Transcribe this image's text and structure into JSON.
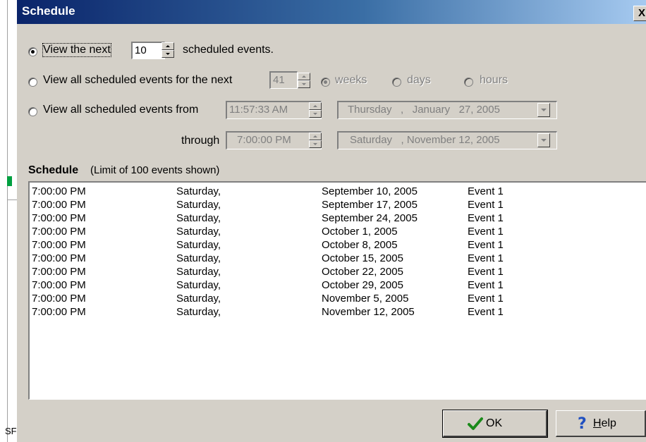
{
  "left_strip": {
    "fragment_text": "SF"
  },
  "dialog": {
    "title": "Schedule",
    "close_label": "X"
  },
  "options": {
    "next_events": {
      "label_prefix": "View the next",
      "value": "10",
      "label_suffix": "scheduled events.",
      "selected": true
    },
    "next_period": {
      "label": "View all scheduled events for the next",
      "value": "41",
      "units": [
        "weeks",
        "days",
        "hours"
      ],
      "selected_unit": "weeks"
    },
    "date_range": {
      "label_from": "View all scheduled events from",
      "from_time": "11:57:33 AM",
      "from_date": "Thursday   ,   January   27, 2005",
      "label_through": "through",
      "through_time": "7:00:00 PM",
      "through_date": "Saturday   , November 12, 2005"
    }
  },
  "schedule": {
    "heading": "Schedule",
    "limit_note": "(Limit of 100 events shown)",
    "rows": [
      {
        "time": "7:00:00 PM",
        "day": "Saturday,",
        "date": "September 10, 2005",
        "event": "Event 1"
      },
      {
        "time": "7:00:00 PM",
        "day": "Saturday,",
        "date": "September 17, 2005",
        "event": "Event 1"
      },
      {
        "time": "7:00:00 PM",
        "day": "Saturday,",
        "date": "September 24, 2005",
        "event": "Event 1"
      },
      {
        "time": "7:00:00 PM",
        "day": "Saturday,",
        "date": "October 1, 2005",
        "event": "Event 1"
      },
      {
        "time": "7:00:00 PM",
        "day": "Saturday,",
        "date": "October 8, 2005",
        "event": "Event 1"
      },
      {
        "time": "7:00:00 PM",
        "day": "Saturday,",
        "date": "October 15, 2005",
        "event": "Event 1"
      },
      {
        "time": "7:00:00 PM",
        "day": "Saturday,",
        "date": "October 22, 2005",
        "event": "Event 1"
      },
      {
        "time": "7:00:00 PM",
        "day": "Saturday,",
        "date": "October 29, 2005",
        "event": "Event 1"
      },
      {
        "time": "7:00:00 PM",
        "day": "Saturday,",
        "date": "November 5, 2005",
        "event": "Event 1"
      },
      {
        "time": "7:00:00 PM",
        "day": "Saturday,",
        "date": "November 12, 2005",
        "event": "Event 1"
      }
    ]
  },
  "buttons": {
    "ok_label": "OK",
    "help_label_prefix": "",
    "help_label_accel": "H",
    "help_label_rest": "elp"
  },
  "icons": {
    "ok": "checkmark-icon",
    "help": "question-mark-icon",
    "check_color": "#1a8a1a",
    "help_color": "#1f4fc0"
  },
  "colors": {
    "titlebar_start": "#0a246a",
    "titlebar_end": "#a6caf0",
    "dialog_bg": "#d4d0c8"
  }
}
